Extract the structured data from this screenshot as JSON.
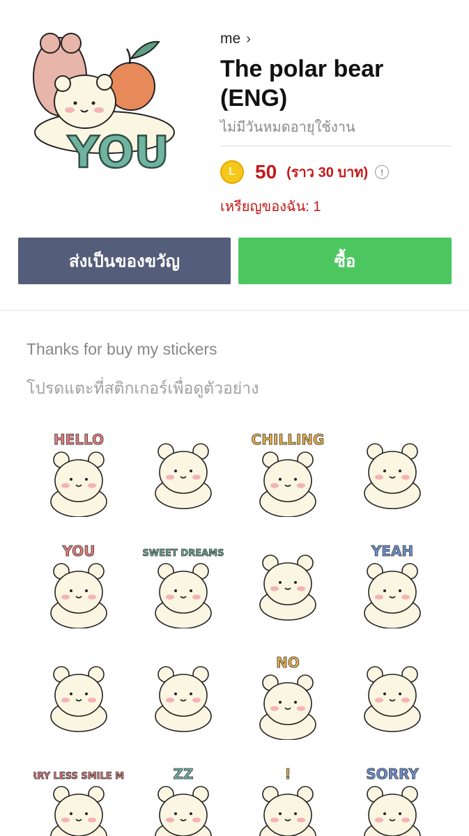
{
  "product": {
    "author": "me",
    "title": "The polar bear (ENG)",
    "validity": "ไม่มีวันหมดอายุใช้งาน",
    "price": "50",
    "price_approx": "(ราว 30 บาท)",
    "my_coins": "เหรียญของฉัน: 1",
    "coin_letter": "L",
    "main_sticker_text": "YOU"
  },
  "actions": {
    "gift_label": "ส่งเป็นของขวัญ",
    "buy_label": "ซื้อ"
  },
  "info": {
    "description": "Thanks for buy my stickers",
    "preview_hint": "โปรดแตะที่สติกเกอร์เพื่อดูตัวอย่าง"
  },
  "stickers": [
    {
      "icon": "bear-hello-sticker",
      "text": "HELLO"
    },
    {
      "icon": "bear-cape-sticker",
      "text": ""
    },
    {
      "icon": "bear-chilling-sticker",
      "text": "CHILLING"
    },
    {
      "icon": "bear-covering-face-sticker",
      "text": ""
    },
    {
      "icon": "bear-peach-you-sticker",
      "text": "YOU"
    },
    {
      "icon": "bear-sweet-dreams-sticker",
      "text": "SWEET DREAMS"
    },
    {
      "icon": "bear-standing-sticker",
      "text": ""
    },
    {
      "icon": "bear-yeah-sticker",
      "text": "YEAH"
    },
    {
      "icon": "bear-party-hat-sticker",
      "text": ""
    },
    {
      "icon": "bear-eating-sticker",
      "text": ""
    },
    {
      "icon": "bear-no-sticker",
      "text": "NO"
    },
    {
      "icon": "bear-hearts-sticker",
      "text": ""
    },
    {
      "icon": "bear-worry-less-sticker",
      "text": "WORRY LESS SMILE MORE"
    },
    {
      "icon": "bear-sleepy-sticker",
      "text": "ZZ"
    },
    {
      "icon": "bear-surprised-sticker",
      "text": "!"
    },
    {
      "icon": "bear-sorry-sticker",
      "text": "SORRY"
    }
  ],
  "colors": {
    "gift_button": "#545d79",
    "buy_button": "#4cc760",
    "price_red": "#c41818",
    "coin_gold": "#f5c81a",
    "bear_cream": "#fbf6e2"
  }
}
